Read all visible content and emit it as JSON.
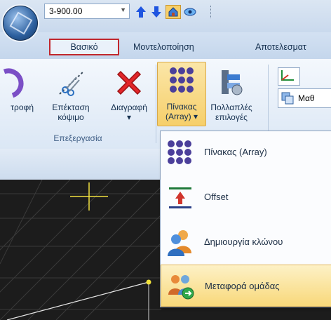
{
  "toolbar": {
    "level_value": "3-900.00"
  },
  "tabs": [
    {
      "label": "Βασικό",
      "selected": true
    },
    {
      "label": "Μοντελοποίηση"
    },
    {
      "label": "Αποτελεσματ"
    }
  ],
  "ribbon": {
    "buttons": [
      {
        "label": "τροφή"
      },
      {
        "label1": "Επέκταση",
        "label2": "κόψιμο"
      },
      {
        "label1": "Διαγραφή",
        "label2": "▾"
      },
      {
        "label1": "Πίνακας",
        "label2": "(Array) ▾"
      },
      {
        "label1": "Πολλαπλές",
        "label2": "επιλογές"
      }
    ],
    "group_label": "Επεξεργασία",
    "right_field_text": "Μαθ"
  },
  "menu": {
    "items": [
      {
        "label": "Πίνακας (Array)",
        "icon": "array-icon"
      },
      {
        "label": "Offset",
        "icon": "offset-icon"
      },
      {
        "label": "Δημιουργία κλώνου",
        "icon": "clone-users-icon"
      },
      {
        "label": "Μεταφορά ομάδας",
        "icon": "move-group-icon",
        "highlighted": true
      }
    ]
  },
  "colors": {
    "accent_red": "#c1272d",
    "highlight": "#f8d87a",
    "canvas_bg": "#1c1c1c"
  }
}
